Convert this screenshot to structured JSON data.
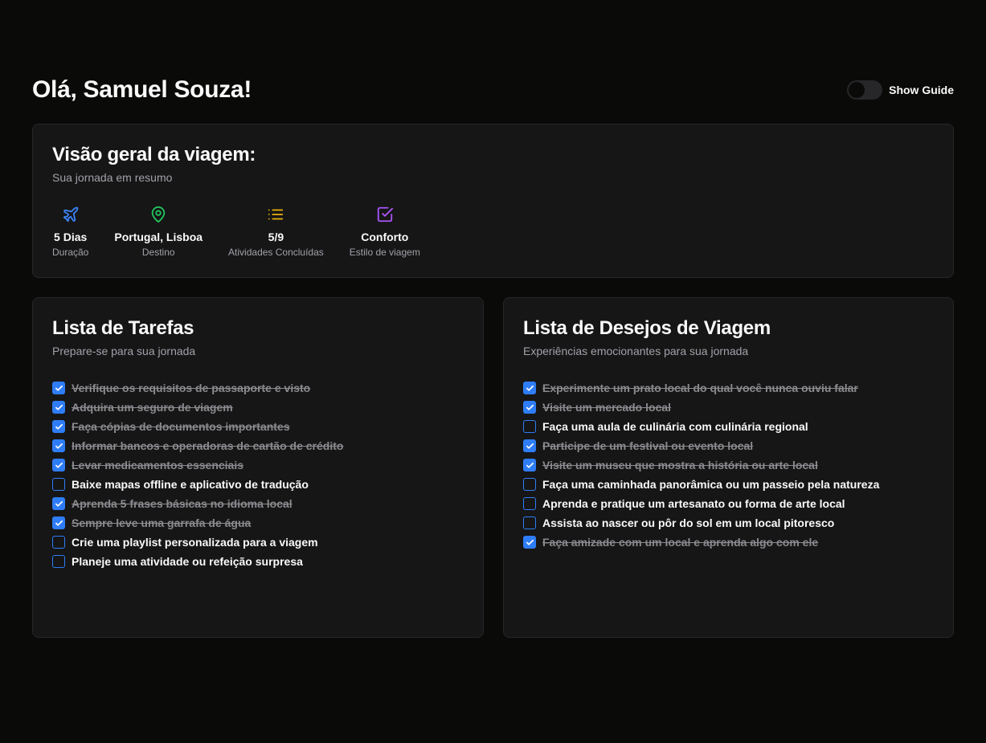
{
  "header": {
    "greeting": "Olá, Samuel Souza!",
    "guide_label": "Show Guide",
    "guide_enabled": false
  },
  "overview": {
    "title": "Visão geral da viagem:",
    "subtitle": "Sua jornada em resumo",
    "stats": [
      {
        "icon": "plane-icon",
        "value": "5 Dias",
        "label": "Duração",
        "color": "#3b82f6"
      },
      {
        "icon": "map-pin-icon",
        "value": "Portugal, Lisboa",
        "label": "Destino",
        "color": "#22c55e"
      },
      {
        "icon": "list-icon",
        "value": "5/9",
        "label": "Atividades Concluídas",
        "color": "#eab308"
      },
      {
        "icon": "check-square-icon",
        "value": "Conforto",
        "label": "Estilo de viagem",
        "color": "#a855f7"
      }
    ]
  },
  "tasks": {
    "title": "Lista de Tarefas",
    "subtitle": "Prepare-se para sua jornada",
    "items": [
      {
        "label": "Verifique os requisitos de passaporte e visto",
        "checked": true
      },
      {
        "label": "Adquira um seguro de viagem",
        "checked": true
      },
      {
        "label": "Faça cópias de documentos importantes",
        "checked": true
      },
      {
        "label": "Informar bancos e operadoras de cartão de crédito",
        "checked": true
      },
      {
        "label": "Levar medicamentos essenciais",
        "checked": true
      },
      {
        "label": "Baixe mapas offline e aplicativo de tradução",
        "checked": false
      },
      {
        "label": "Aprenda 5 frases básicas no idioma local",
        "checked": true
      },
      {
        "label": "Sempre leve uma garrafa de água",
        "checked": true
      },
      {
        "label": "Crie uma playlist personalizada para a viagem",
        "checked": false
      },
      {
        "label": "Planeje uma atividade ou refeição surpresa",
        "checked": false
      }
    ]
  },
  "wishes": {
    "title": "Lista de Desejos de Viagem",
    "subtitle": "Experiências emocionantes para sua jornada",
    "items": [
      {
        "label": "Experimente um prato local do qual você nunca ouviu falar",
        "checked": true
      },
      {
        "label": "Visite um mercado local",
        "checked": true
      },
      {
        "label": "Faça uma aula de culinária com culinária regional",
        "checked": false
      },
      {
        "label": "Participe de um festival ou evento local",
        "checked": true
      },
      {
        "label": "Visite um museu que mostra a história ou arte local",
        "checked": true
      },
      {
        "label": "Faça uma caminhada panorâmica ou um passeio pela natureza",
        "checked": false
      },
      {
        "label": "Aprenda e pratique um artesanato ou forma de arte local",
        "checked": false
      },
      {
        "label": "Assista ao nascer ou pôr do sol em um local pitoresco",
        "checked": false
      },
      {
        "label": "Faça amizade com um local e aprenda algo com ele",
        "checked": true
      }
    ]
  },
  "colors": {
    "background": "#0a0a09",
    "card": "#161616",
    "accent": "#2f7df6"
  }
}
